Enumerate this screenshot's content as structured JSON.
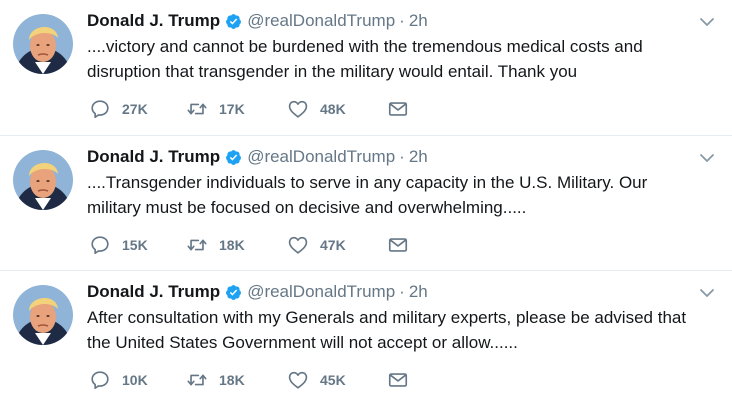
{
  "tweets": [
    {
      "author_name": "Donald J. Trump",
      "handle": "@realDonaldTrump",
      "separator": "·",
      "time": "2h",
      "text_lines": [
        "....victory and cannot be burdened with the tremendous medical costs and",
        "disruption that transgender in the military would entail. Thank you"
      ],
      "replies": "27K",
      "retweets": "17K",
      "likes": "48K"
    },
    {
      "author_name": "Donald J. Trump",
      "handle": "@realDonaldTrump",
      "separator": "·",
      "time": "2h",
      "text_lines": [
        "....Transgender individuals to  serve in any capacity in the U.S. Military. Our",
        "military must be focused on decisive and overwhelming....."
      ],
      "replies": "15K",
      "retweets": "18K",
      "likes": "47K"
    },
    {
      "author_name": "Donald J. Trump",
      "handle": "@realDonaldTrump",
      "separator": "·",
      "time": "2h",
      "text_lines": [
        "After consultation with my Generals and military experts, please be advised that",
        "the United States Government will not accept or allow......"
      ],
      "replies": "10K",
      "retweets": "18K",
      "likes": "45K"
    }
  ],
  "icons": {
    "verified": "verified-badge-icon",
    "caret": "chevron-down-icon",
    "reply": "reply-icon",
    "retweet": "retweet-icon",
    "like": "heart-icon",
    "dm": "envelope-icon"
  },
  "colors": {
    "verified_blue": "#1da1f2",
    "secondary_text": "#657786",
    "primary_text": "#14171a",
    "divider": "#e6ecf0"
  }
}
